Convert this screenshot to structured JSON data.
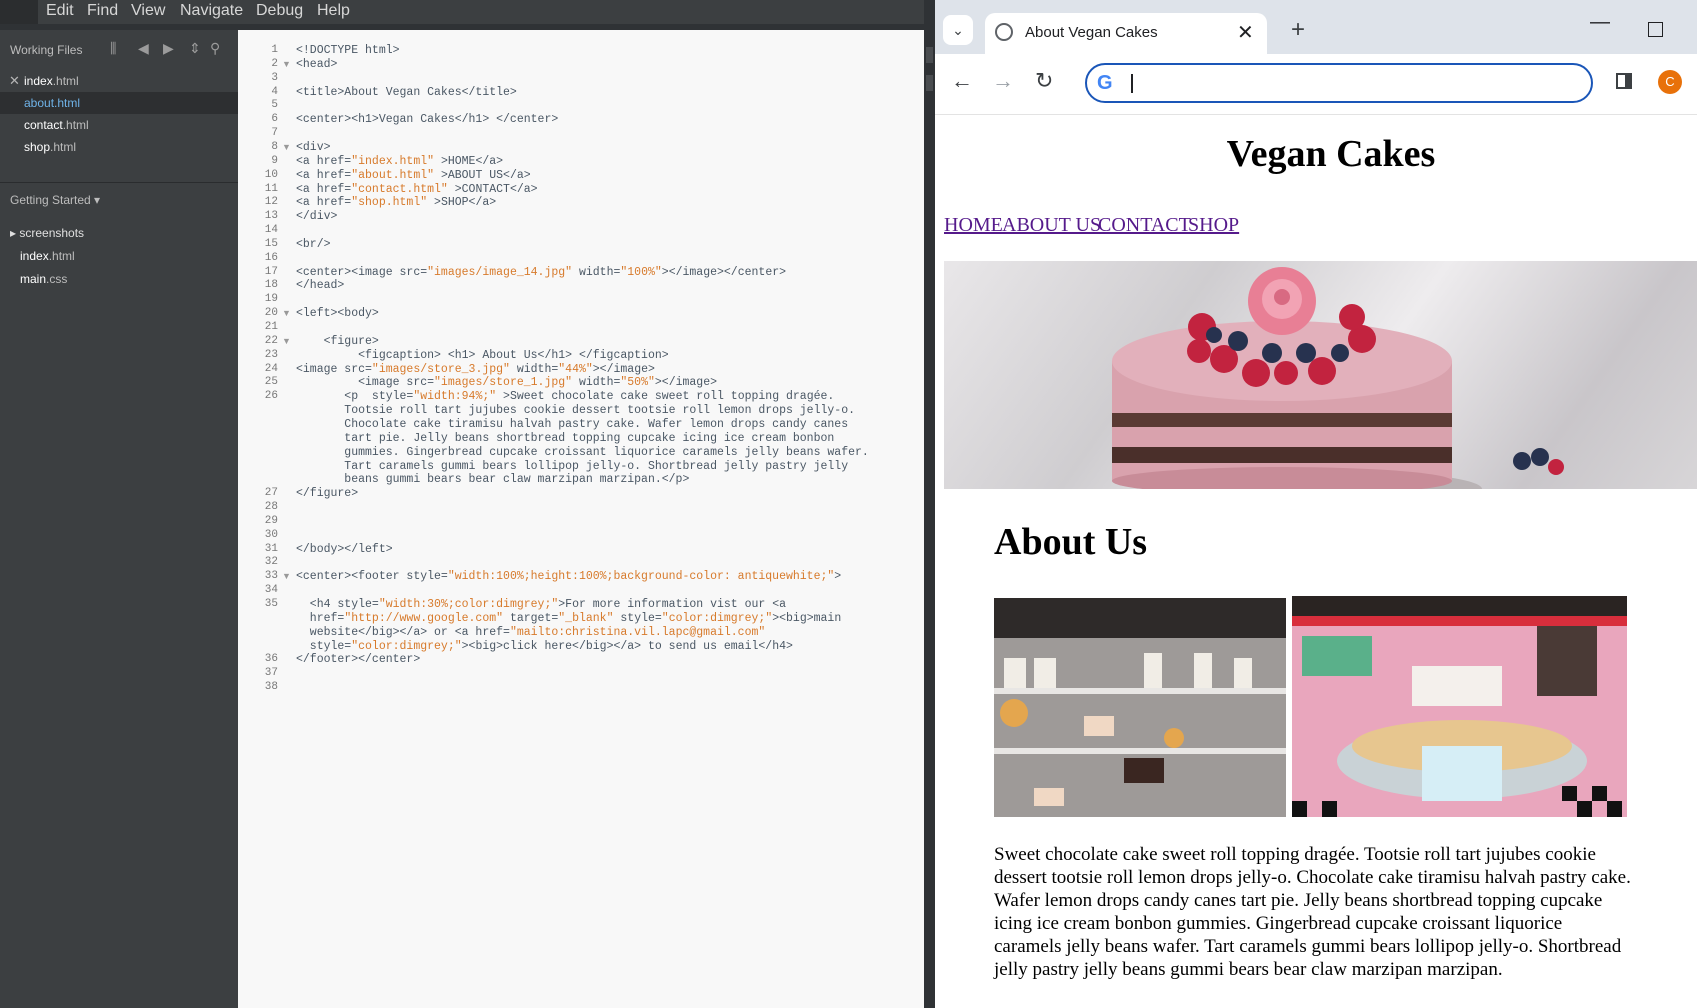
{
  "editor": {
    "menu": [
      "Edit",
      "Find",
      "View",
      "Navigate",
      "Debug",
      "Help"
    ],
    "working_files_title": "Working Files",
    "working_files": [
      {
        "base": "index",
        "ext": ".html"
      },
      {
        "base": "about",
        "ext": ".html"
      },
      {
        "base": "contact",
        "ext": ".html"
      },
      {
        "base": "shop",
        "ext": ".html"
      }
    ],
    "project_title": "Getting Started ▾",
    "tree": [
      {
        "label": "▸ screenshots",
        "base": "",
        "ext": ""
      },
      {
        "label": "",
        "base": "index",
        "ext": ".html"
      },
      {
        "label": "",
        "base": "main",
        "ext": ".css"
      }
    ],
    "code_lines": [
      {
        "n": "1",
        "text": "<!DOCTYPE html>"
      },
      {
        "n": "2",
        "text": "<head>"
      },
      {
        "n": "3",
        "text": ""
      },
      {
        "n": "4",
        "text": "<title>About Vegan Cakes</title>"
      },
      {
        "n": "5",
        "text": ""
      },
      {
        "n": "6",
        "text": "<center><h1>Vegan Cakes</h1> </center>"
      },
      {
        "n": "7",
        "text": ""
      },
      {
        "n": "8",
        "text": "<div>"
      },
      {
        "n": "9",
        "text": "<a href=\"index.html\" >HOME</a>"
      },
      {
        "n": "10",
        "text": "<a href=\"about.html\" >ABOUT US</a>"
      },
      {
        "n": "11",
        "text": "<a href=\"contact.html\" >CONTACT</a>"
      },
      {
        "n": "12",
        "text": "<a href=\"shop.html\" >SHOP</a>"
      },
      {
        "n": "13",
        "text": "</div>"
      },
      {
        "n": "14",
        "text": ""
      },
      {
        "n": "15",
        "text": "<br/>"
      },
      {
        "n": "16",
        "text": ""
      },
      {
        "n": "17",
        "text": "<center><image src=\"images/image_14.jpg\" width=\"100%\"></image></center>"
      },
      {
        "n": "18",
        "text": "</head>"
      },
      {
        "n": "19",
        "text": ""
      },
      {
        "n": "20",
        "text": "<left><body>"
      },
      {
        "n": "21",
        "text": ""
      },
      {
        "n": "22",
        "text": "    <figure>"
      },
      {
        "n": "23",
        "text": "         <figcaption> <h1> About Us</h1> </figcaption>"
      },
      {
        "n": "24",
        "text": "<image src=\"images/store_3.jpg\" width=\"44%\"></image>"
      },
      {
        "n": "25",
        "text": "         <image src=\"images/store_1.jpg\" width=\"50%\"></image>"
      },
      {
        "n": "26",
        "text": "       <p  style=\"width:94%;\" >Sweet chocolate cake sweet roll topping dragée."
      },
      {
        "n": "",
        "text": "       Tootsie roll tart jujubes cookie dessert tootsie roll lemon drops jelly-o."
      },
      {
        "n": "",
        "text": "       Chocolate cake tiramisu halvah pastry cake. Wafer lemon drops candy canes"
      },
      {
        "n": "",
        "text": "       tart pie. Jelly beans shortbread topping cupcake icing ice cream bonbon"
      },
      {
        "n": "",
        "text": "       gummies. Gingerbread cupcake croissant liquorice caramels jelly beans wafer."
      },
      {
        "n": "",
        "text": "       Tart caramels gummi bears lollipop jelly-o. Shortbread jelly pastry jelly"
      },
      {
        "n": "",
        "text": "       beans gummi bears bear claw marzipan marzipan.</p>"
      },
      {
        "n": "27",
        "text": "</figure>"
      },
      {
        "n": "28",
        "text": ""
      },
      {
        "n": "29",
        "text": ""
      },
      {
        "n": "30",
        "text": ""
      },
      {
        "n": "31",
        "text": "</body></left>"
      },
      {
        "n": "32",
        "text": ""
      },
      {
        "n": "33",
        "text": "<center><footer style=\"width:100%;height:100%;background-color: antiquewhite;\">"
      },
      {
        "n": "34",
        "text": ""
      },
      {
        "n": "35",
        "text": "  <h4 style=\"width:30%;color:dimgrey;\">For more information vist our <a"
      },
      {
        "n": "",
        "text": "  href=\"http://www.google.com\" target=\"_blank\" style=\"color:dimgrey;\"><big>main"
      },
      {
        "n": "",
        "text": "  website</big></a> or <a href=\"mailto:christina.vil.lapc@gmail.com\""
      },
      {
        "n": "",
        "text": "  style=\"color:dimgrey;\"><big>click here</big></a> to send us email</h4>"
      },
      {
        "n": "36",
        "text": "</footer></center>"
      },
      {
        "n": "37",
        "text": ""
      },
      {
        "n": "38",
        "text": ""
      }
    ]
  },
  "browser": {
    "tab_title": "About Vegan Cakes",
    "profile_initial": "C",
    "omnibox_value": "",
    "page": {
      "title": "Vegan Cakes",
      "nav": [
        "HOME",
        "ABOUT US",
        "CONTACT",
        "SHOP"
      ],
      "about_heading": "About Us",
      "about_text": "Sweet chocolate cake sweet roll topping dragée. Tootsie roll tart jujubes cookie dessert tootsie roll lemon drops jelly-o. Chocolate cake tiramisu halvah pastry cake. Wafer lemon drops candy canes tart pie. Jelly beans shortbread topping cupcake icing ice cream bonbon gummies. Gingerbread cupcake croissant liquorice caramels jelly beans wafer. Tart caramels gummi bears lollipop jelly-o. Shortbread jelly pastry jelly beans gummi bears bear claw marzipan marzipan."
    }
  },
  "colors": {
    "code_tag": "#4a5764",
    "code_attr_value": "#d77a2b",
    "link_visited": "#551a8b",
    "omnibox_focus": "#1a56b8",
    "profile_bg": "#e8710a"
  },
  "icons": [
    "close-icon",
    "split-view-icon",
    "arrow-left-icon",
    "arrow-right-icon",
    "sort-icon",
    "search-icon",
    "chevron-down-icon",
    "globe-icon",
    "plus-icon",
    "minimize-icon",
    "maximize-icon",
    "back-icon",
    "forward-icon",
    "reload-icon",
    "google-icon",
    "side-panel-icon"
  ]
}
